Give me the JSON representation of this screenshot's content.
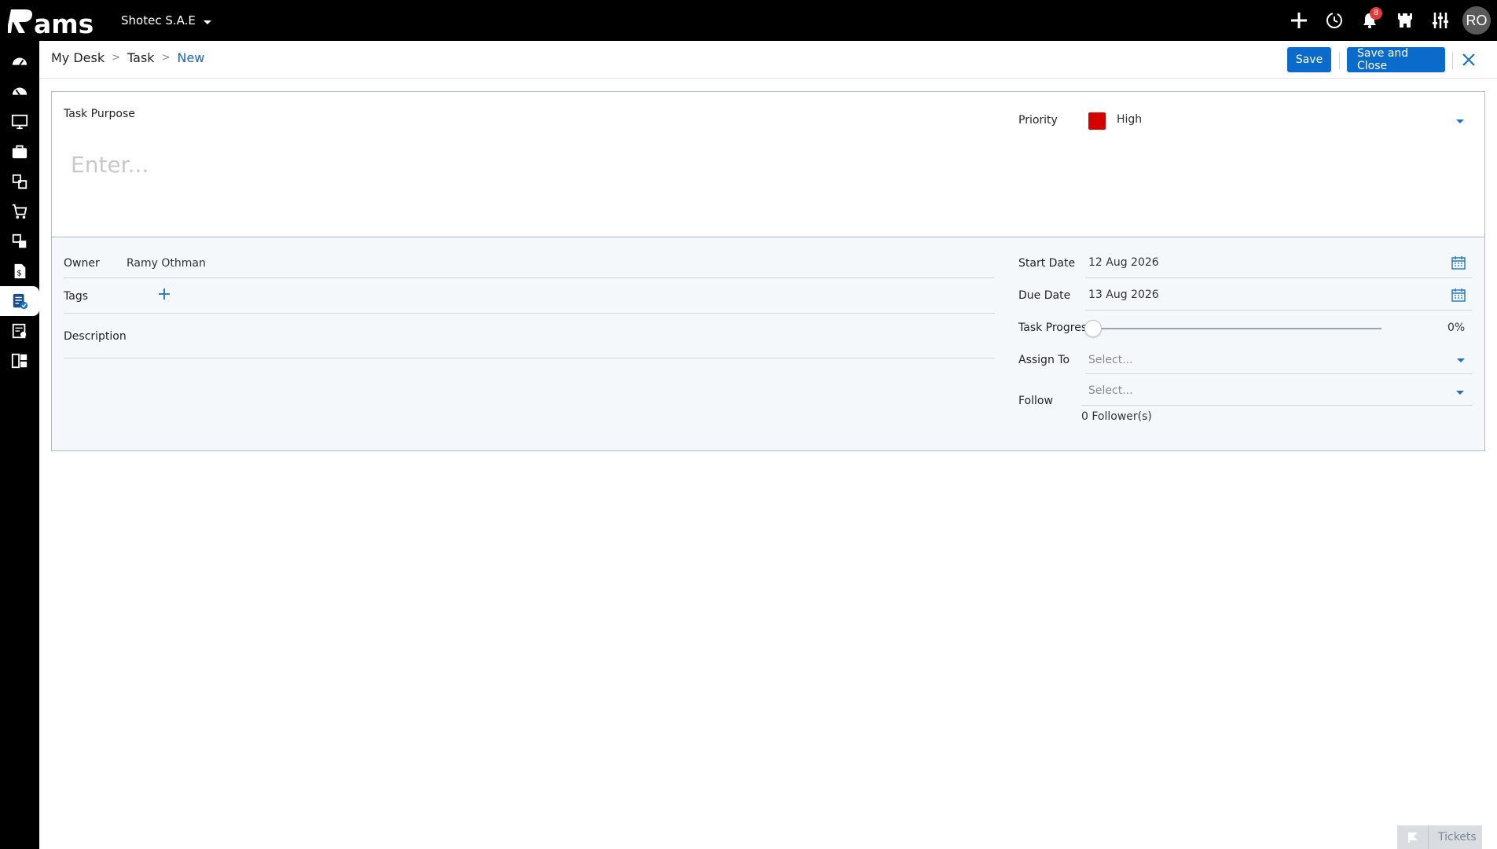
{
  "app": {
    "logo_text": "Rams",
    "company": "Shotec S.A.E",
    "notifications_count": "8",
    "user_initials": "RO"
  },
  "sidebar": {
    "items": [
      {
        "icon": "dashboard-gauge-icon"
      },
      {
        "icon": "dashboard-gauge-alt-icon"
      },
      {
        "icon": "monitor-icon"
      },
      {
        "icon": "briefcase-icon"
      },
      {
        "icon": "modules-icon"
      },
      {
        "icon": "shopping-cart-icon"
      },
      {
        "icon": "modules-alt-icon"
      },
      {
        "icon": "finance-document-icon"
      },
      {
        "icon": "task-list-icon",
        "active": true
      },
      {
        "icon": "invoice-icon"
      },
      {
        "icon": "report-grid-icon"
      }
    ]
  },
  "breadcrumb": {
    "items": [
      "My Desk",
      "Task",
      "New"
    ]
  },
  "toolbar": {
    "save_label": "Save",
    "save_close_label": "Save and Close"
  },
  "form": {
    "task_purpose_label": "Task Purpose",
    "task_purpose_placeholder": "Enter...",
    "priority_label": "Priority",
    "priority_value": "High",
    "priority_color": "#d50000",
    "owner_label": "Owner",
    "owner_value": "Ramy Othman",
    "tags_label": "Tags",
    "description_label": "Description",
    "start_date_label": "Start Date",
    "start_date_value": "12 Aug 2026",
    "due_date_label": "Due Date",
    "due_date_value": "13 Aug 2026",
    "task_progress_label": "Task Progress",
    "task_progress_value": "0%",
    "task_progress_fraction": 0,
    "assign_to_label": "Assign To",
    "assign_to_placeholder": "Select...",
    "follow_label": "Follow",
    "follow_placeholder": "Select...",
    "followers_text": "0 Follower(s)"
  },
  "footer": {
    "tickets_label": "Tickets"
  },
  "colors": {
    "accent": "#0a6bcb",
    "topbar": "#000000"
  }
}
